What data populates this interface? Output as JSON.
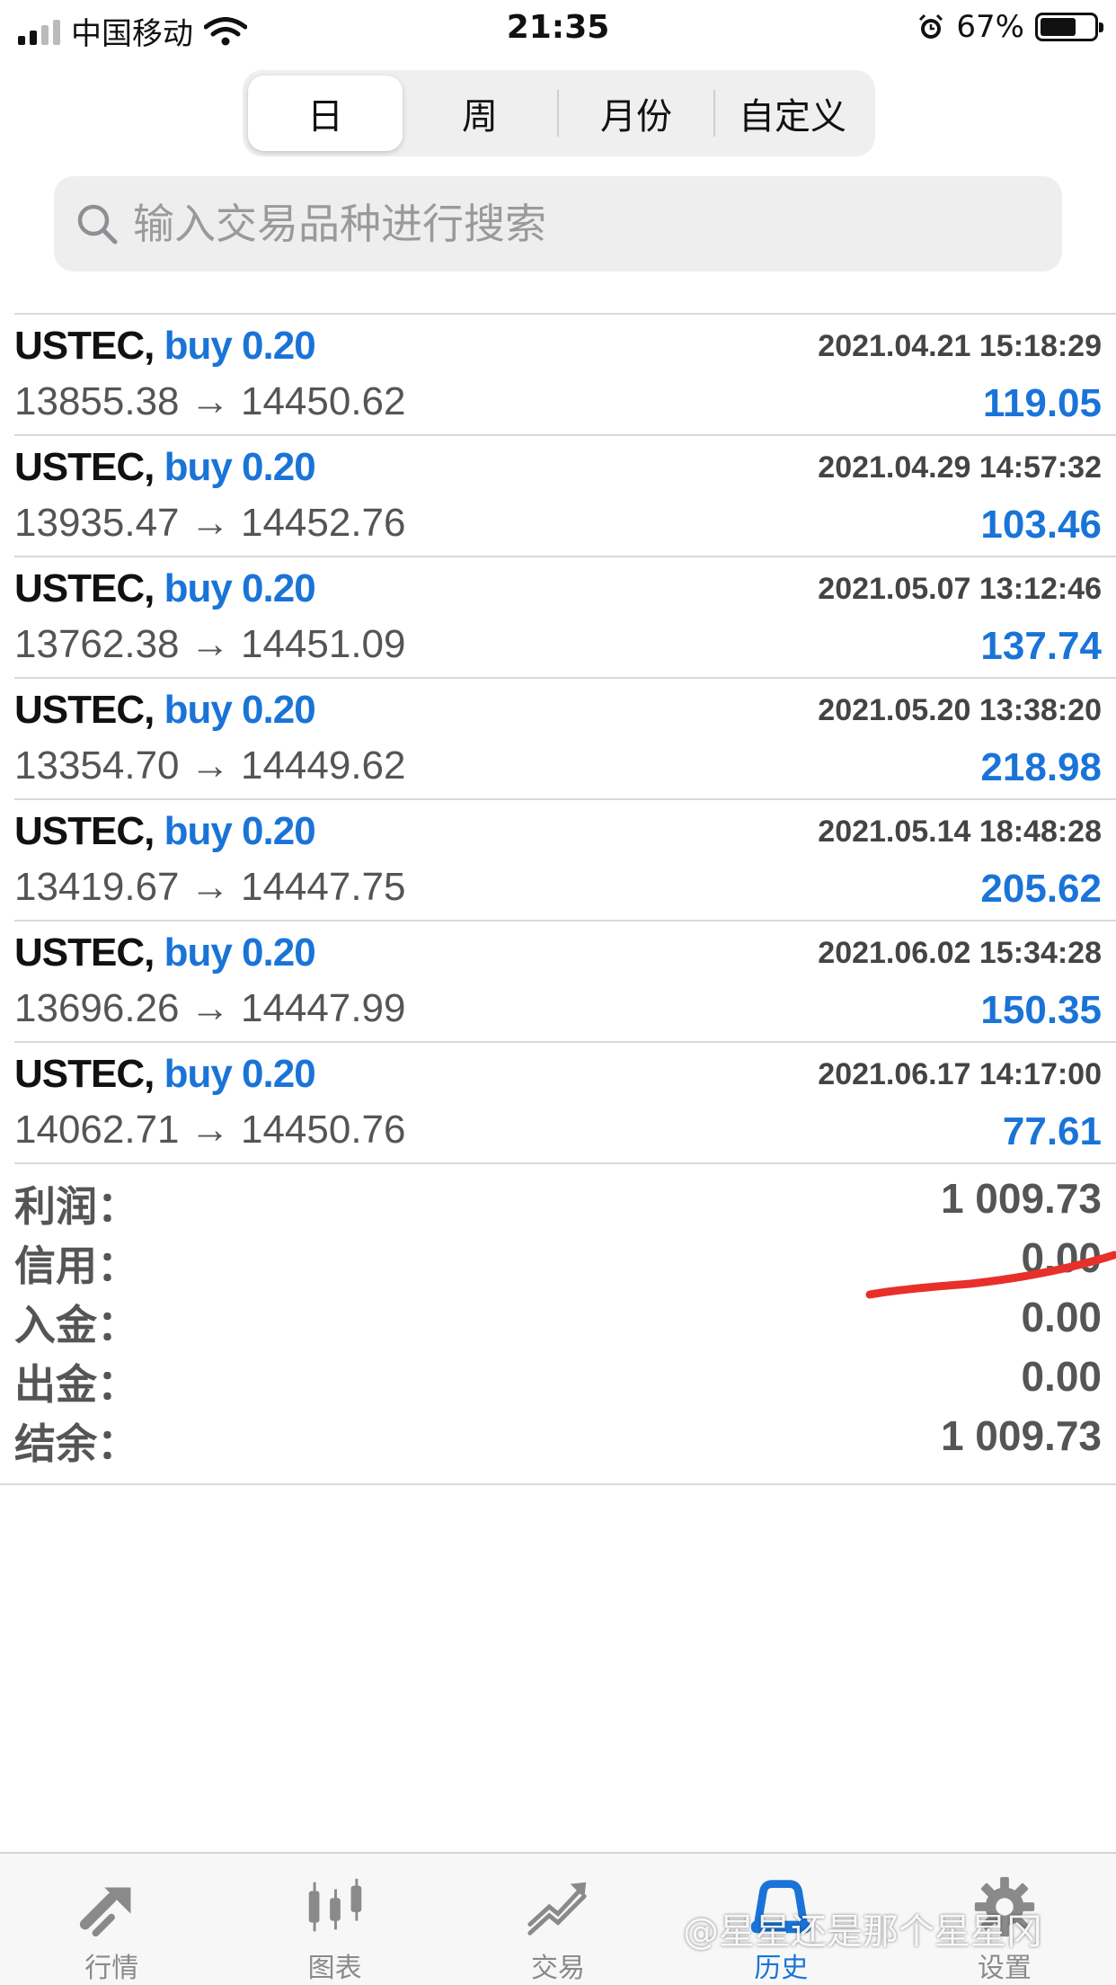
{
  "status_bar": {
    "carrier": "中国移动",
    "time": "21:35",
    "battery": "67%"
  },
  "segments": [
    {
      "label": "日",
      "active": true
    },
    {
      "label": "周",
      "active": false
    },
    {
      "label": "月份",
      "active": false
    },
    {
      "label": "自定义",
      "active": false
    }
  ],
  "search": {
    "placeholder": "输入交易品种进行搜索"
  },
  "deals": [
    {
      "symbol": "USTEC,",
      "side": "buy 0.20",
      "time": "2021.04.21 15:18:29",
      "prices": "13855.38 → 14450.62",
      "profit": "119.05"
    },
    {
      "symbol": "USTEC,",
      "side": "buy 0.20",
      "time": "2021.04.29 14:57:32",
      "prices": "13935.47 → 14452.76",
      "profit": "103.46"
    },
    {
      "symbol": "USTEC,",
      "side": "buy 0.20",
      "time": "2021.05.07 13:12:46",
      "prices": "13762.38 → 14451.09",
      "profit": "137.74"
    },
    {
      "symbol": "USTEC,",
      "side": "buy 0.20",
      "time": "2021.05.20 13:38:20",
      "prices": "13354.70 → 14449.62",
      "profit": "218.98"
    },
    {
      "symbol": "USTEC,",
      "side": "buy 0.20",
      "time": "2021.05.14 18:48:28",
      "prices": "13419.67 → 14447.75",
      "profit": "205.62"
    },
    {
      "symbol": "USTEC,",
      "side": "buy 0.20",
      "time": "2021.06.02 15:34:28",
      "prices": "13696.26 → 14447.99",
      "profit": "150.35"
    },
    {
      "symbol": "USTEC,",
      "side": "buy 0.20",
      "time": "2021.06.17 14:17:00",
      "prices": "14062.71 → 14450.76",
      "profit": "77.61"
    }
  ],
  "summary": {
    "profit": {
      "label": "利润：",
      "value": "1 009.73"
    },
    "credit": {
      "label": "信用：",
      "value": "0.00"
    },
    "deposit": {
      "label": "入金：",
      "value": "0.00"
    },
    "withdrawal": {
      "label": "出金：",
      "value": "0.00"
    },
    "balance": {
      "label": "结余：",
      "value": "1 009.73"
    }
  },
  "tabs": [
    {
      "label": "行情",
      "icon": "quotes-icon",
      "active": false
    },
    {
      "label": "图表",
      "icon": "chart-icon",
      "active": false
    },
    {
      "label": "交易",
      "icon": "trade-icon",
      "active": false
    },
    {
      "label": "历史",
      "icon": "history-icon",
      "active": true
    },
    {
      "label": "设置",
      "icon": "settings-icon",
      "active": false
    }
  ],
  "watermark": "@星星还是那个星星冈",
  "colors": {
    "accent": "#1a74d8",
    "annotation": "#e8302a"
  }
}
